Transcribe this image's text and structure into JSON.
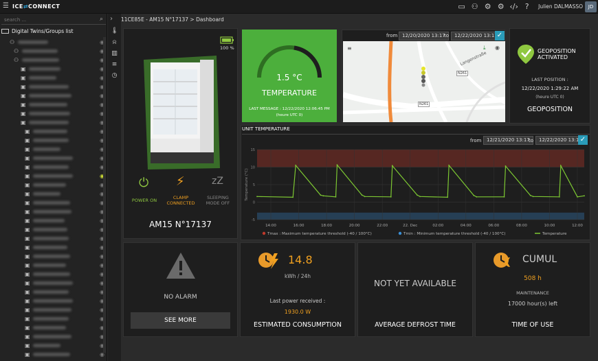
{
  "app": {
    "logo_left": "ICE",
    "logo_mid": "⇄",
    "logo_right": "CONNECT",
    "user_name": "Julien DALMASSO",
    "user_initials": "JD"
  },
  "sidebar": {
    "search_placeholder": "search ...",
    "root_label": "Digital Twins/Groups list"
  },
  "breadcrumb": "11CE85E - AM15 N°17137 > Dashboard",
  "device": {
    "battery": "100 %",
    "name": "AM15 N°17137",
    "power": "POWER ON",
    "clamp_line1": "CLAMP",
    "clamp_line2": "CONNECTED",
    "sleep_line1": "SLEEPING",
    "sleep_line2": "MODE OFF",
    "power_color": "#8fc840",
    "clamp_color": "#f0a020",
    "sleep_color": "#8a8a8a"
  },
  "temperature": {
    "value": "1.5 °C",
    "label": "TEMPERATURE",
    "last_message": "LAST MESSAGE : 12/22/2020 12:06:45 PM",
    "timezone": "(heure UTC 0)",
    "gauge_fraction": 0.55,
    "bg_color": "#4caf3c"
  },
  "map": {
    "from_label": "from",
    "from_date": "12/20/2020 13:17",
    "to_label": "to",
    "to_date": "12/22/2020 13:17",
    "street": "Langenstraße",
    "road1": "N261",
    "road2": "N261"
  },
  "geoposition": {
    "status_line1": "GEOPOSITION",
    "status_line2": "ACTIVATED",
    "last_position_label": "LAST POSITION :",
    "last_position_date": "12/22/2020 1:29:22 AM",
    "timezone": "(heure UTC 0)",
    "title": "GEOPOSITION"
  },
  "unit_temperature": {
    "title": "UNIT TEMPERATURE",
    "from_label": "from",
    "from_date": "12/21/2020 13:17",
    "to_label": "to",
    "to_date": "12/22/2020 13:17"
  },
  "chart_data": {
    "type": "line",
    "title": "UNIT TEMPERATURE",
    "ylabel": "Temperature (°C)",
    "ylim": [
      -5,
      15
    ],
    "yticks": [
      -5,
      0,
      5,
      10,
      15
    ],
    "x_ticks": [
      "14:00",
      "16:00",
      "18:00",
      "20:00",
      "22:00",
      "22. Dec",
      "02:00",
      "04:00",
      "06:00",
      "08:00",
      "10:00",
      "12:00"
    ],
    "grid": true,
    "legend_position": "bottom",
    "series": [
      {
        "name": "Tmax : Maximum temperature threshold (-40 / 100°C)",
        "color": "#c0392b",
        "kind": "band",
        "from": 10,
        "to": 15
      },
      {
        "name": "Tmin : Minimum temperature threshold (-40 / 100°C)",
        "color": "#3a8fd6",
        "kind": "band",
        "from": -5,
        "to": -3
      },
      {
        "name": "Temperature",
        "color": "#7dc832",
        "kind": "line",
        "x": [
          13.3,
          15.9,
          16.1,
          17.9,
          18.1,
          19.0,
          19.1,
          20.9,
          21.1,
          23.0,
          23.1,
          24.9,
          25.1,
          27.1,
          27.2,
          29.0,
          29.2,
          31.2,
          31.3,
          33.1,
          33.3,
          35.2,
          35.3,
          36.5,
          37.0
        ],
        "y": [
          1.6,
          1.4,
          10.5,
          2.0,
          1.8,
          1.5,
          10.6,
          2.0,
          1.6,
          1.5,
          10.4,
          2.0,
          1.6,
          1.4,
          10.5,
          1.9,
          1.5,
          1.5,
          10.3,
          1.9,
          1.6,
          1.5,
          10.4,
          1.5,
          1.8
        ]
      }
    ]
  },
  "alarm": {
    "text": "NO ALARM",
    "button": "SEE MORE"
  },
  "consumption": {
    "value": "14.8",
    "unit": "kWh / 24h",
    "last_power_label": "Last power received :",
    "last_power_value": "1930.0 W",
    "title": "ESTIMATED CONSUMPTION"
  },
  "defrost": {
    "text": "NOT YET AVAILABLE",
    "title": "AVERAGE DEFROST TIME"
  },
  "time_of_use": {
    "cumul_label": "CUMUL",
    "hours": "508 h",
    "maintenance_label": "MAINTENANCE",
    "maintenance_value": "17000 hour(s) left",
    "title": "TIME OF USE"
  }
}
